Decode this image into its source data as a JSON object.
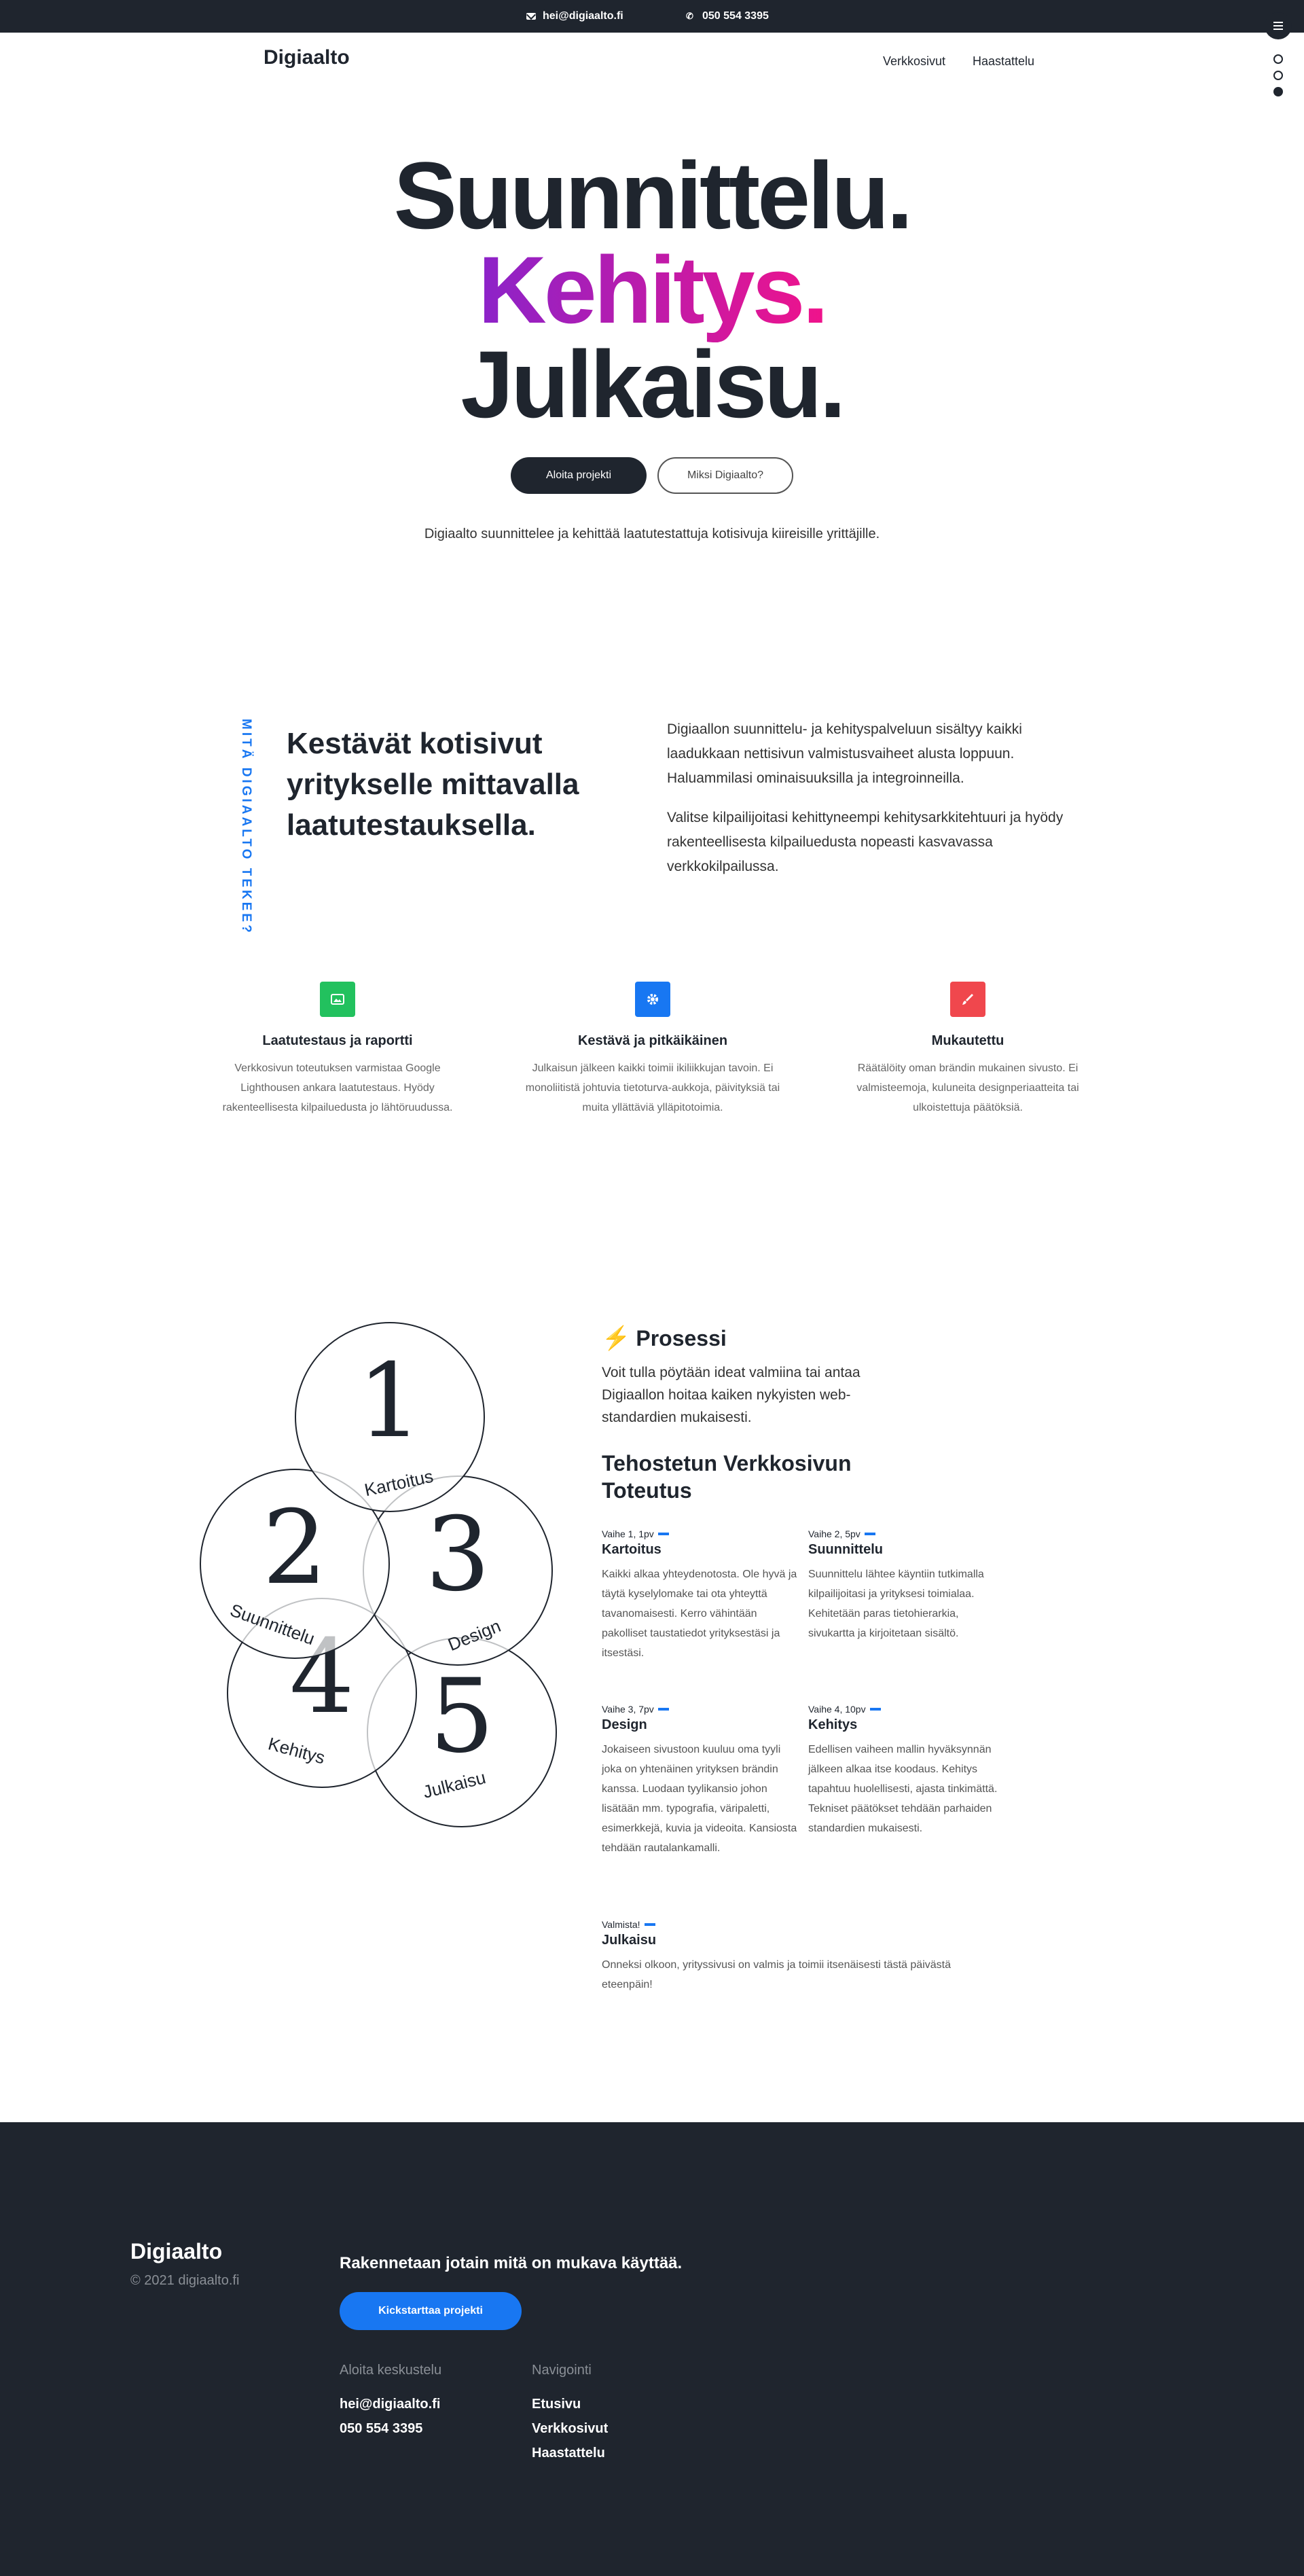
{
  "topbar": {
    "email": "hei@digiaalto.fi",
    "phone": "050 554 3395",
    "email_icon": "mail-icon",
    "phone_icon": "phone-icon",
    "menu_icon": "hamburger-menu-icon"
  },
  "nav": {
    "brand": "Digiaalto",
    "links": [
      "Verkkosivut",
      "Haastattelu"
    ],
    "slide_dots": [
      "dot",
      "dot",
      "dot-active"
    ]
  },
  "hero": {
    "line1": "Suunnittelu.",
    "line2": "Kehitys.",
    "line3": "Julkaisu.",
    "primary_button": "Aloita projekti",
    "secondary_button": "Miksi Digiaalto?",
    "subtitle": "Digiaalto suunnittelee ja kehittää laatutestattuja kotisivuja kiireisille yrittäjille.",
    "gradient_colors": [
      "#8b23c9",
      "#f0138b"
    ]
  },
  "what": {
    "vertical_label": "MITÄ DIGIAALTO TEKEE?",
    "heading": "Kestävät kotisivut yritykselle mittavalla laatutestauksella.",
    "paragraph1": "Digiaallon suunnittelu- ja kehityspalveluun sisältyy kaikki laadukkaan nettisivun valmistusvaiheet alusta loppuun. Haluammilasi ominaisuuksilla ja integroinneilla.",
    "paragraph2": "Valitse kilpailijoitasi kehittyneempi kehitysarkkitehtuuri ja hyödy rakenteellisesta kilpailuedusta nopeasti kasvavassa verkkokilpailussa.",
    "accent_color": "#1877f2"
  },
  "features": [
    {
      "icon": "image-icon",
      "color": "#22c15e",
      "title": "Laatutestaus ja raportti",
      "text": "Verkkosivun toteutuksen varmistaa Google Lighthousen ankara laatutestaus. Hyödy rakenteellisesta kilpailuedusta jo lähtöruudussa."
    },
    {
      "icon": "gear-icon",
      "color": "#1877f2",
      "title": "Kestävä ja pitkäikäinen",
      "text": "Julkaisun jälkeen kaikki toimii ikiliikkujan tavoin. Ei monoliitistä johtuvia tietoturva-aukkoja, päivityksiä tai muita yllättäviä ylläpitotoimia."
    },
    {
      "icon": "brush-icon",
      "color": "#f0474d",
      "title": "Mukautettu",
      "text": "Räätälöity oman brändin mukainen sivusto. Ei valmisteemoja, kuluneita designperiaatteita tai ulkoistettuja päätöksiä."
    }
  ],
  "process": {
    "circles": [
      {
        "num": "1",
        "label": "Kartoitus"
      },
      {
        "num": "2",
        "label": "Suunnittelu"
      },
      {
        "num": "3",
        "label": "Design"
      },
      {
        "num": "4",
        "label": "Kehitys"
      },
      {
        "num": "5",
        "label": "Julkaisu"
      }
    ],
    "title_icon": "lightning-icon",
    "title": "Prosessi",
    "intro": "Voit tulla pöytään ideat valmiina tai antaa Digiaallon hoitaa kaiken nykyisten web-standardien mukaisesti.",
    "subtitle": "Tehostetun Verkkosivun Toteutus",
    "phases": [
      {
        "label": "Vaihe 1, 1pv",
        "title": "Kartoitus",
        "text": "Kaikki alkaa yhteydenotosta. Ole hyvä ja täytä kyselylomake tai ota yhteyttä tavanomaisesti. Kerro vähintään pakolliset taustatiedot yrityksestäsi ja itsestäsi."
      },
      {
        "label": "Vaihe 2, 5pv",
        "title": "Suunnittelu",
        "text": "Suunnittelu lähtee käyntiin tutkimalla kilpailijoitasi ja yrityksesi toimialaa. Kehitetään paras tietohierarkia, sivukartta ja kirjoitetaan sisältö."
      },
      {
        "label": "Vaihe 3, 7pv",
        "title": "Design",
        "text": "Jokaiseen sivustoon kuuluu oma tyyli joka on yhtenäinen yrityksen brändin kanssa. Luodaan tyylikansio johon lisätään mm. typografia, väripaletti, esimerkkejä, kuvia ja videoita. Kansiosta tehdään rautalankamalli."
      },
      {
        "label": "Vaihe 4, 10pv",
        "title": "Kehitys",
        "text": "Edellisen vaiheen mallin hyväksynnän jälkeen alkaa itse koodaus. Kehitys tapahtuu huolellisesti, ajasta tinkimättä. Tekniset päätökset tehdään parhaiden standardien mukaisesti."
      },
      {
        "label": "Valmista!",
        "title": "Julkaisu",
        "text": "Onneksi olkoon, yrityssivusi on valmis ja toimii itsenäisesti tästä päivästä eteenpäin!"
      }
    ]
  },
  "footer": {
    "brand": "Digiaalto",
    "copyright": "© 2021 digiaalto.fi",
    "tagline": "Rakennetaan jotain mitä on mukava käyttää.",
    "cta_button": "Kickstarttaa projekti",
    "contact_title": "Aloita keskustelu",
    "contact_email": "hei@digiaalto.fi",
    "contact_phone": "050 554 3395",
    "nav_title": "Navigointi",
    "nav_links": [
      "Etusivu",
      "Verkkosivut",
      "Haastattelu"
    ]
  }
}
